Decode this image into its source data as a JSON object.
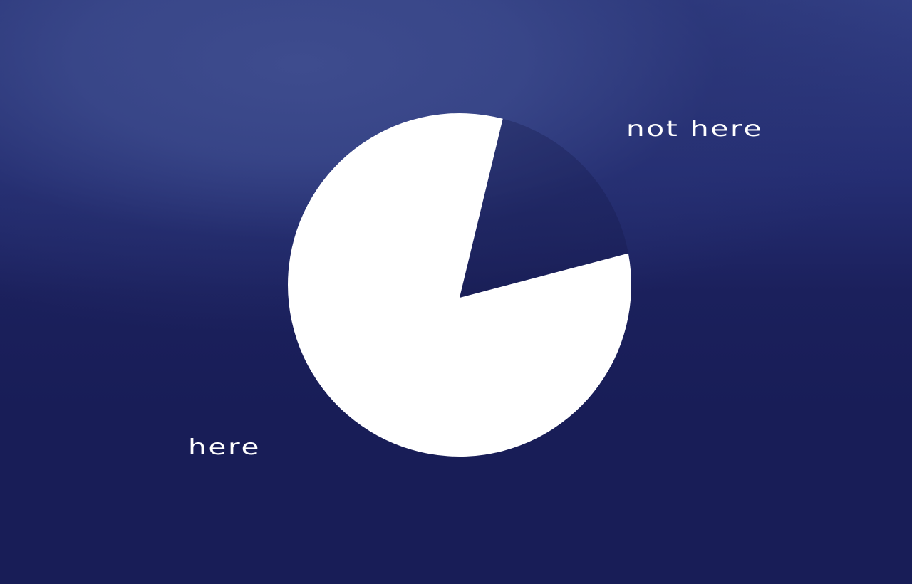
{
  "chart_data": {
    "type": "pie",
    "title": "",
    "slices": [
      {
        "label": "not here",
        "value": 18,
        "color": "#1d2461"
      },
      {
        "label": "here",
        "value": 82,
        "color": "#ffffff"
      }
    ],
    "start_angle_deg": 14.6,
    "legend": "none"
  },
  "colors": {
    "background_top": "#3b4a8a",
    "background_bottom": "#181d57",
    "text": "#ffffff"
  }
}
